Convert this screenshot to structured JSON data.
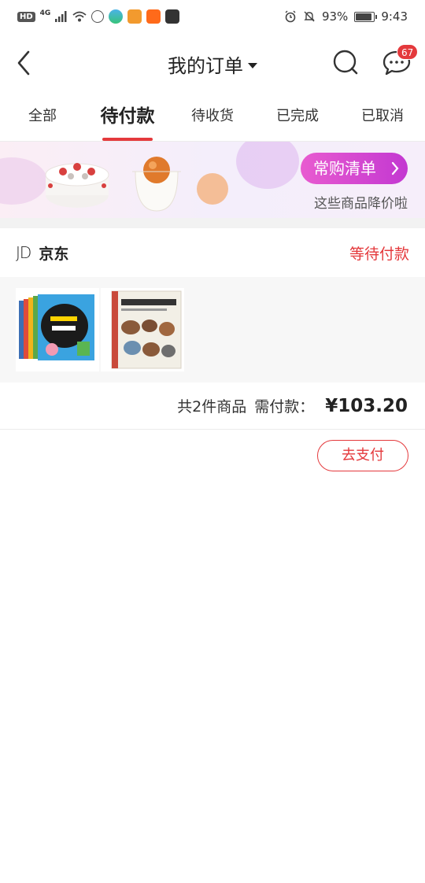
{
  "status_bar": {
    "hd": "HD",
    "network": "4G",
    "battery_pct": "93%",
    "battery_level": 0.93,
    "time": "9:43"
  },
  "header": {
    "title": "我的订单",
    "message_count": "67"
  },
  "tabs": [
    {
      "label": "全部",
      "active": false
    },
    {
      "label": "待付款",
      "active": true
    },
    {
      "label": "待收货",
      "active": false
    },
    {
      "label": "已完成",
      "active": false
    },
    {
      "label": "已取消",
      "active": false
    }
  ],
  "banner": {
    "button_label": "常购清单",
    "subtitle": "这些商品降价啦"
  },
  "order": {
    "shop_logo": "JD",
    "shop_name": "京东",
    "status": "等待付款",
    "item_count_text": "共2件商品",
    "pay_label": "需付款：",
    "amount": "¥103.20",
    "pay_button": "去支付",
    "product_icons": [
      "book-set-image",
      "book-cover-image"
    ]
  },
  "colors": {
    "accent": "#e4393c",
    "banner_button": "#d644d0"
  }
}
